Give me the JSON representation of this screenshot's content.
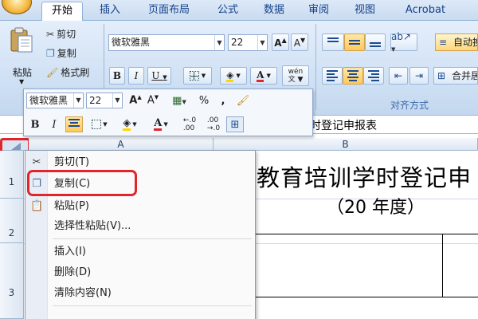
{
  "tabs": [
    "开始",
    "插入",
    "页面布局",
    "公式",
    "数据",
    "审阅",
    "视图",
    "Acrobat"
  ],
  "ribbon": {
    "paste_label": "粘贴",
    "cut_label": "剪切",
    "copy_label": "复制",
    "format_painter_label": "格式刷",
    "font_name": "微软雅黑",
    "font_size": "22",
    "wrap_text_label": "自动换",
    "merge_label": "合并居",
    "alignment_group_label": "对齐方式",
    "font_color": "#e0262b",
    "highlight_color": "#ffd700"
  },
  "mini_toolbar": {
    "font_name": "微软雅黑",
    "font_size": "22",
    "percent": "%",
    "comma": ","
  },
  "formula_bar": {
    "content": "教育培训学时登记申报表"
  },
  "grid": {
    "col_a": "A",
    "col_b": "B",
    "rows": [
      "1",
      "2",
      "3"
    ],
    "title": "部教育培训学时登记申",
    "subtitle": "（20  年度）"
  },
  "context_menu": {
    "items": [
      "剪切(T)",
      "复制(C)",
      "粘贴(P)",
      "选择性粘贴(V)...",
      "插入(I)",
      "删除(D)",
      "清除内容(N)"
    ]
  },
  "highlight_color": "#e0262b"
}
